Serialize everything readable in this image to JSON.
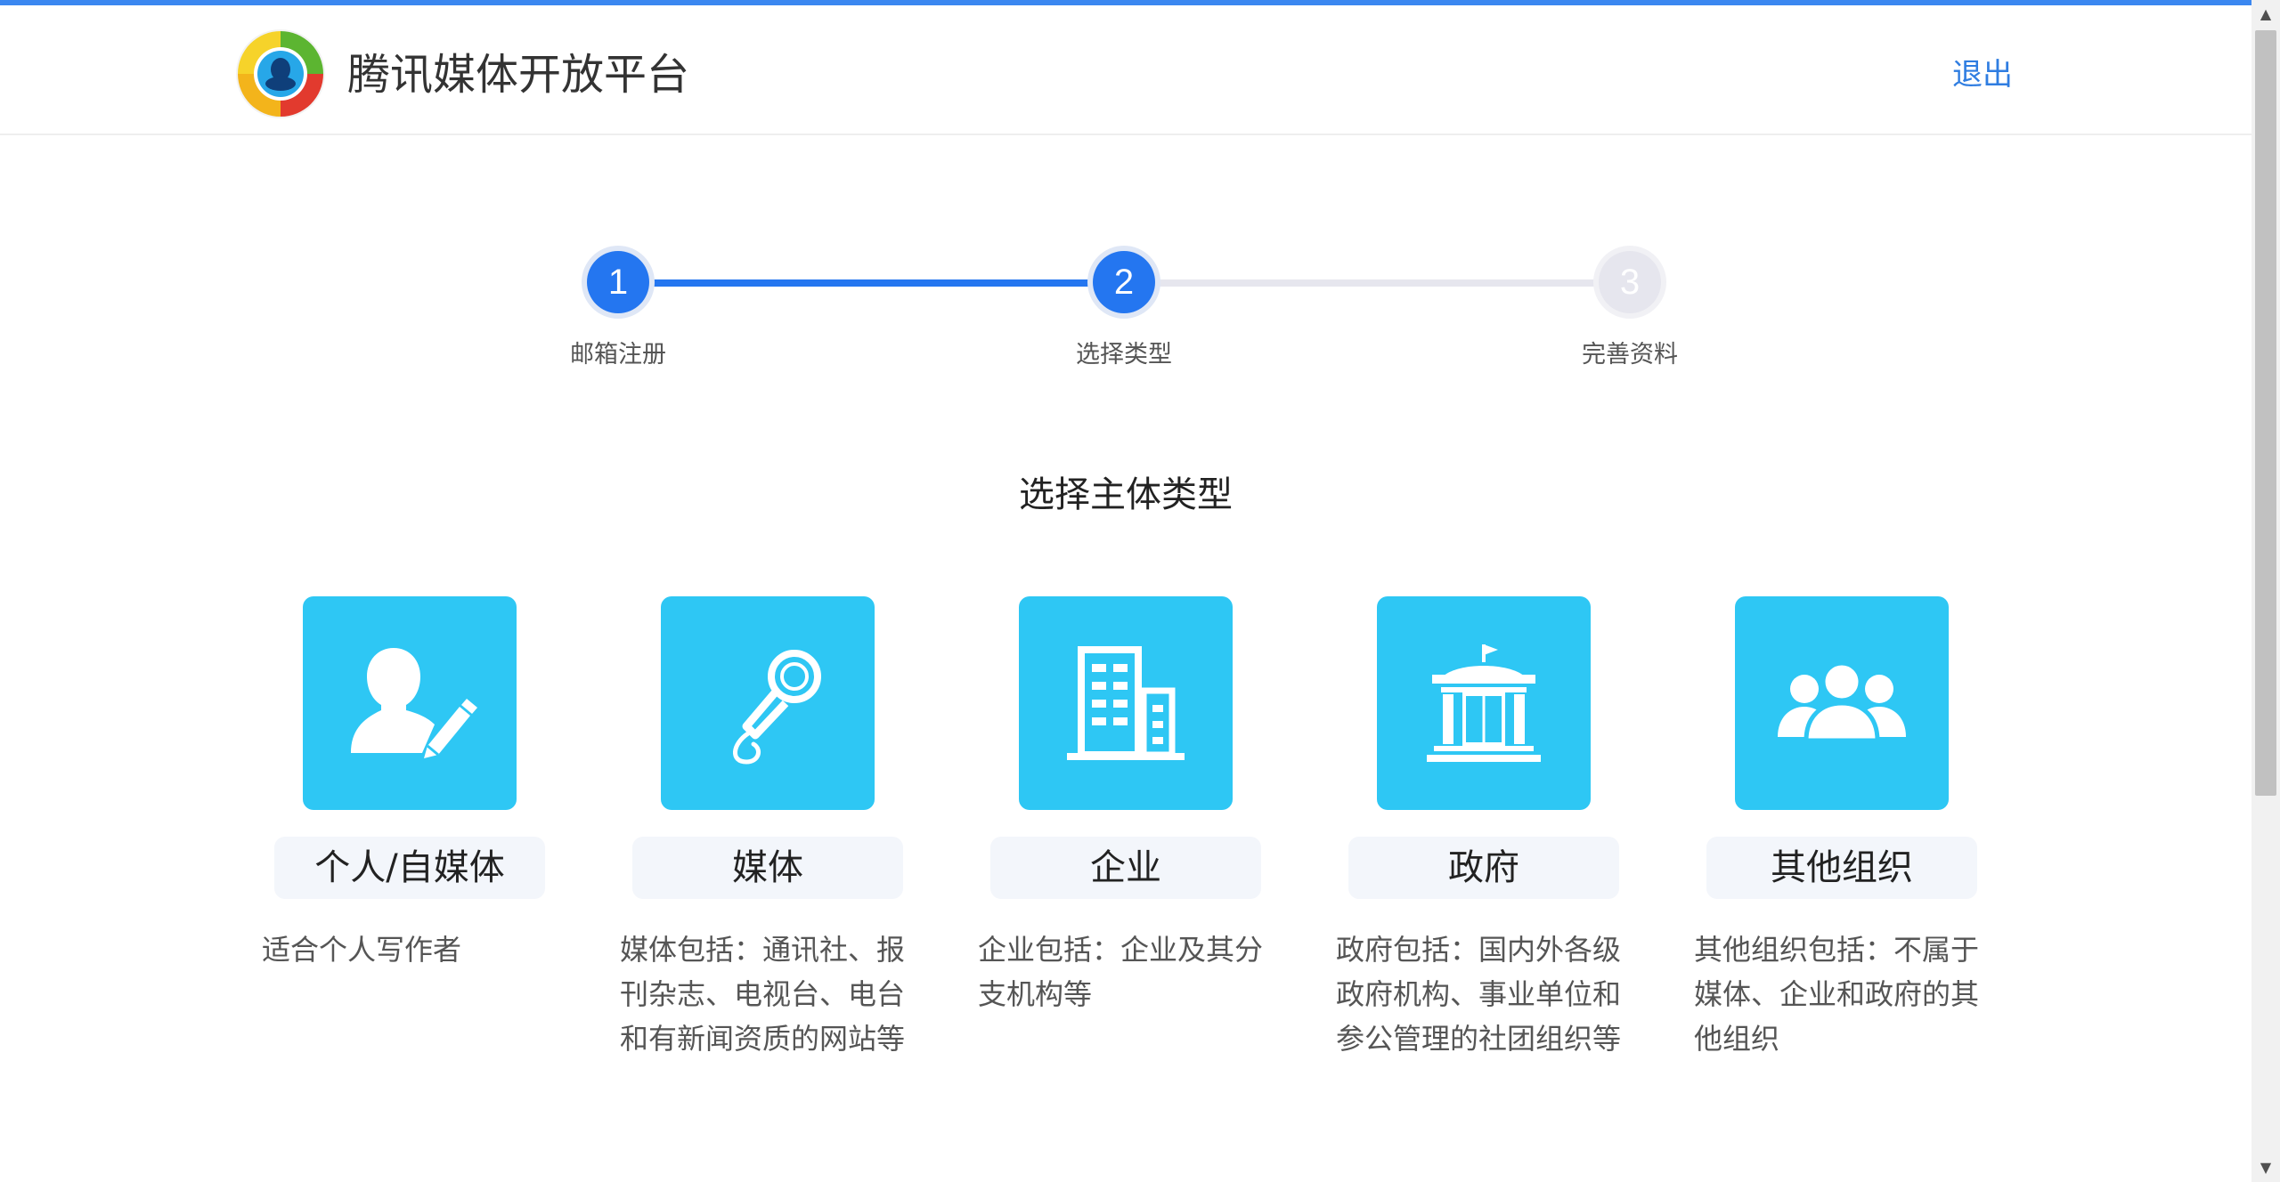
{
  "header": {
    "brand": "腾讯媒体开放平台",
    "logout_label": "退出"
  },
  "steps": [
    {
      "number": "1",
      "label": "邮箱注册",
      "state": "done"
    },
    {
      "number": "2",
      "label": "选择类型",
      "state": "current"
    },
    {
      "number": "3",
      "label": "完善资料",
      "state": "todo"
    }
  ],
  "section_title": "选择主体类型",
  "types": [
    {
      "name": "个人/自媒体",
      "icon": "user-pen-icon",
      "description": "适合个人写作者"
    },
    {
      "name": "媒体",
      "icon": "microphone-icon",
      "description": "媒体包括：通讯社、报刊杂志、电视台、电台和有新闻资质的网站等"
    },
    {
      "name": "企业",
      "icon": "building-icon",
      "description": "企业包括：企业及其分支机构等"
    },
    {
      "name": "政府",
      "icon": "government-building-icon",
      "description": "政府包括：国内外各级政府机构、事业单位和参公管理的社团组织等"
    },
    {
      "name": "其他组织",
      "icon": "group-icon",
      "description": "其他组织包括：不属于媒体、企业和政府的其他组织"
    }
  ],
  "colors": {
    "accent": "#2476f0",
    "tile": "#2ec7f4",
    "link": "#2f7de1"
  }
}
